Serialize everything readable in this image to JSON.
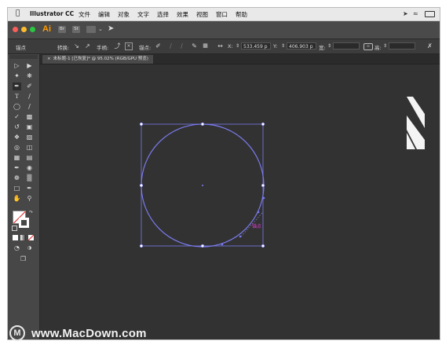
{
  "menubar": {
    "apple_icon": "apple-icon",
    "app_name": "Illustrator CC",
    "items": [
      "文件",
      "编辑",
      "对象",
      "文字",
      "选择",
      "效果",
      "视图",
      "窗口",
      "帮助"
    ]
  },
  "appbar": {
    "logo": "Ai",
    "icons": [
      "Br",
      "St"
    ],
    "colors": {
      "close": "#fc5f57",
      "minimize": "#fdbc2e",
      "zoom": "#28c840",
      "logo": "#ff9a00"
    }
  },
  "control_bar": {
    "anchor_label": "锚点",
    "convert_label": "转换:",
    "handle_label": "手柄:",
    "anchor_points_label": "锚点:",
    "x_label": "X:",
    "x_value": "533.459 p",
    "y_label": "Y:",
    "y_value": "406.903 p",
    "w_label": "宽:",
    "h_label": "高:"
  },
  "document": {
    "tab_title": "未标题-1 [已恢复]* @ 95.02% (RGB/GPU 预览)"
  },
  "canvas": {
    "hover_label": "锚点",
    "selection_color": "#7b7bf0",
    "hover_color": "#e23bd6"
  },
  "watermark": {
    "logo_letter": "M",
    "text": "www.MacDown.com"
  }
}
